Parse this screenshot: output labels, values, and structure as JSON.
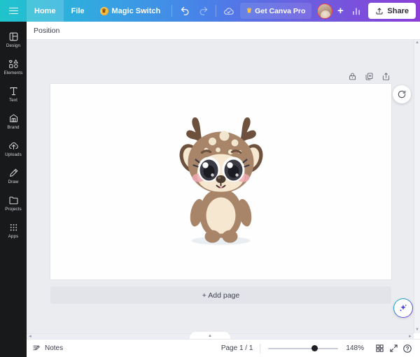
{
  "topbar": {
    "menu_icon": "hamburger-icon",
    "home_label": "Home",
    "file_label": "File",
    "magic_switch_label": "Magic Switch",
    "undo_icon": "undo-icon",
    "redo_icon": "redo-icon",
    "cloud_saved_icon": "cloud-check-icon",
    "pro_label": "Get Canva Pro",
    "pro_crown": "♛",
    "plus_label": "+",
    "stats_icon": "bar-chart-icon",
    "share_label": "Share",
    "share_icon": "share-upload-icon",
    "gradient_start": "#20c4cb",
    "gradient_end": "#8b3fd6"
  },
  "sidebar": {
    "items": [
      {
        "label": "Design",
        "icon": "design-icon"
      },
      {
        "label": "Elements",
        "icon": "elements-icon"
      },
      {
        "label": "Text",
        "icon": "text-icon"
      },
      {
        "label": "Brand",
        "icon": "brand-icon"
      },
      {
        "label": "Uploads",
        "icon": "uploads-icon"
      },
      {
        "label": "Draw",
        "icon": "draw-icon"
      },
      {
        "label": "Projects",
        "icon": "projects-icon"
      },
      {
        "label": "Apps",
        "icon": "apps-icon"
      }
    ]
  },
  "subbar": {
    "position_label": "Position"
  },
  "editor": {
    "page_tools": [
      {
        "name": "lock-icon"
      },
      {
        "name": "duplicate-page-icon"
      },
      {
        "name": "expand-page-icon"
      }
    ],
    "refresh_icon": "refresh-icon",
    "magic_icon": "magic-sparkle-icon",
    "add_page_label": "+ Add page",
    "canvas_background": "#fefefe",
    "editor_background": "#ebecf0",
    "artwork": {
      "name": "cartoon-baby-deer",
      "body_color": "#a88568",
      "belly_color": "#f5e7d0",
      "antler_color": "#6d513c",
      "eye_color": "#3a3a44",
      "cheek_color": "#f0a8b4",
      "spot_color": "#f2e6cf"
    }
  },
  "bottombar": {
    "notes_label": "Notes",
    "notes_icon": "notes-icon",
    "page_count": "Page 1 / 1",
    "zoom_value": "148%",
    "zoom_percent": 148,
    "grid_icon": "grid-view-icon",
    "fullscreen_icon": "fullscreen-icon",
    "help_icon": "help-icon"
  },
  "scroll": {
    "up_arrow": "▲",
    "down_arrow": "▼",
    "left_arrow": "◄",
    "right_arrow": "►",
    "collapse_arrow": "▲"
  }
}
